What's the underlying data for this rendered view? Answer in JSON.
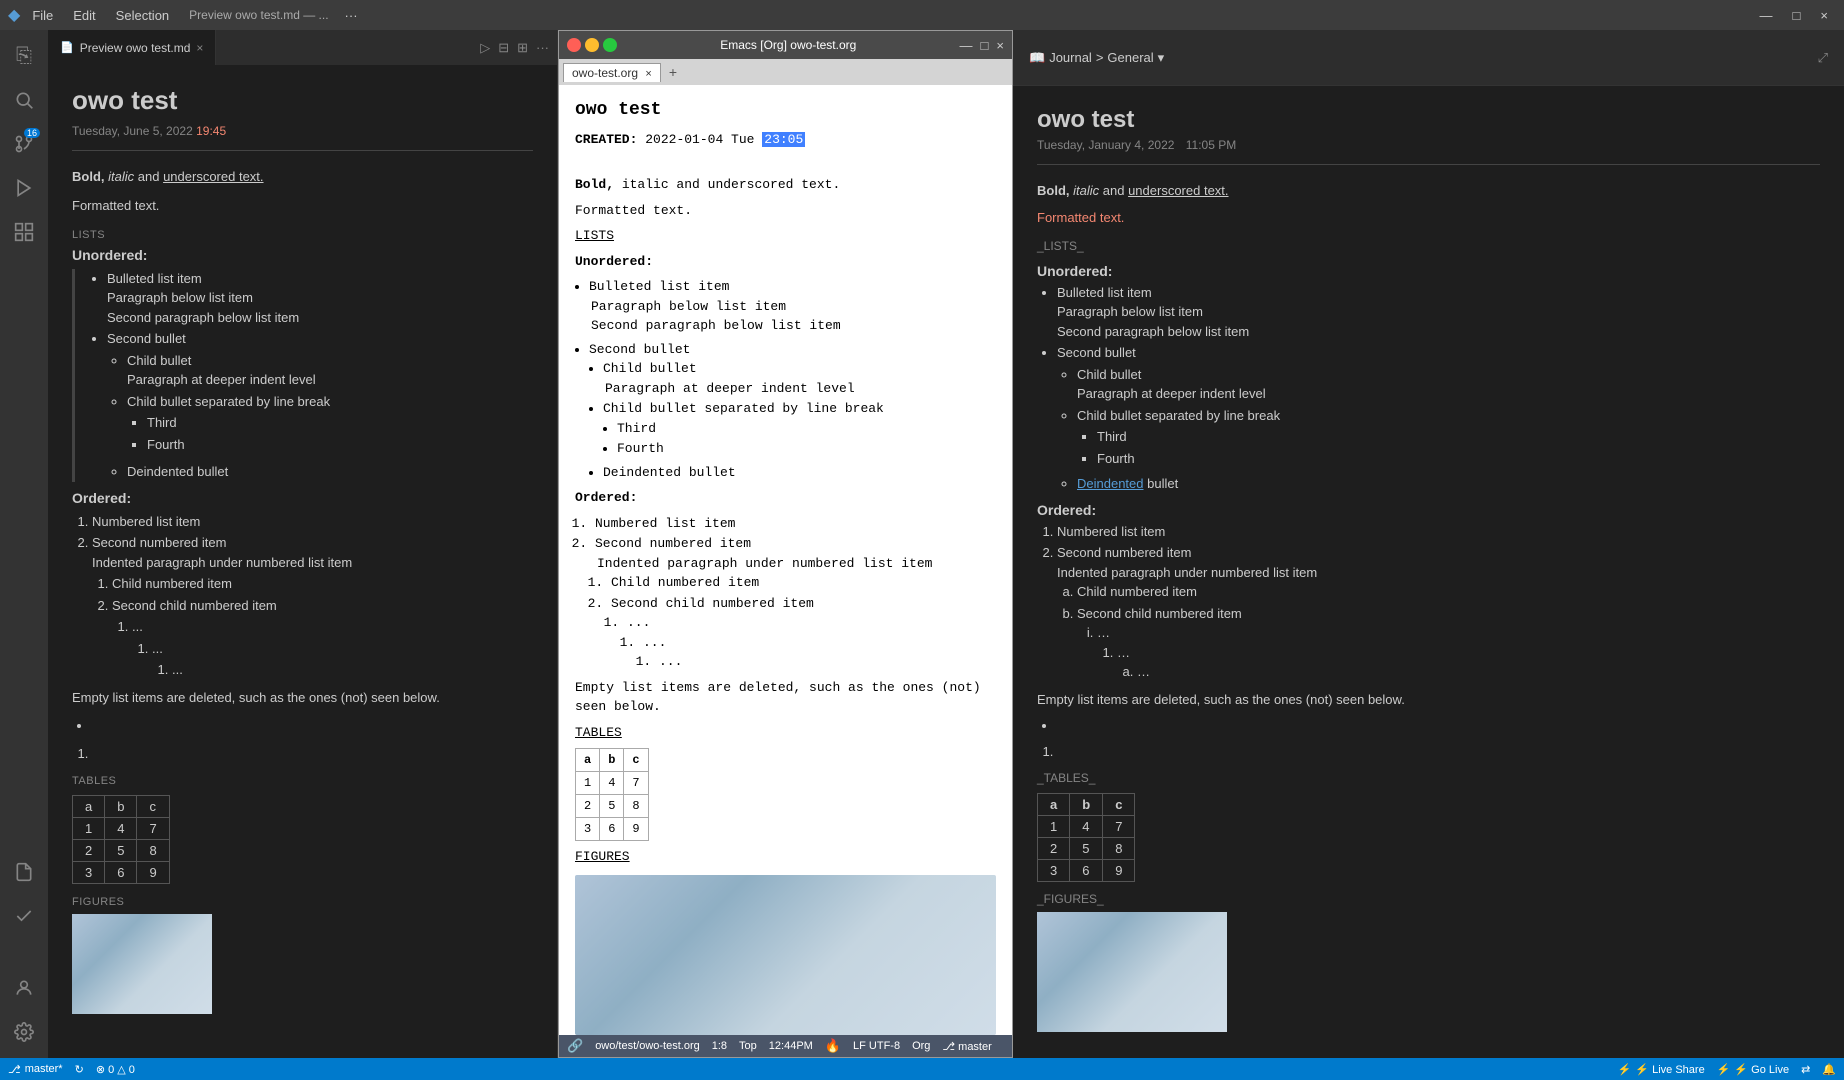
{
  "menubar": {
    "app_icon": "◆",
    "items": [
      "File",
      "Edit",
      "Selection",
      "Preview owo test.md — ...",
      ""
    ],
    "selection_label": "Selection",
    "file_label": "File",
    "edit_label": "Edit",
    "dots": "···"
  },
  "activity_bar": {
    "icons": [
      {
        "name": "explorer-icon",
        "symbol": "⎘",
        "active": false
      },
      {
        "name": "search-icon",
        "symbol": "🔍",
        "active": false
      },
      {
        "name": "source-control-icon",
        "symbol": "⎇",
        "badge": "16",
        "active": false
      },
      {
        "name": "run-icon",
        "symbol": "▷",
        "active": false
      },
      {
        "name": "extensions-icon",
        "symbol": "⊞",
        "active": false
      },
      {
        "name": "notes-icon",
        "symbol": "📝",
        "active": false
      },
      {
        "name": "todo-icon",
        "symbol": "✓",
        "active": false
      },
      {
        "name": "settings-icon",
        "symbol": "⚙",
        "active": false
      },
      {
        "name": "account-icon",
        "symbol": "👤",
        "active": false
      }
    ]
  },
  "vscode_panel": {
    "tab": {
      "icon": "📄",
      "label": "Preview owo test.md",
      "close": "×"
    },
    "toolbar": {
      "play_icon": "▷",
      "split_icon": "⊟",
      "grid_icon": "⊞",
      "more_icon": "···"
    },
    "content": {
      "title": "owo test",
      "date": "Tuesday, June 5, 2022",
      "time": "19:45",
      "line1_bold": "Bold,",
      "line1_italic": "italic",
      "line1_rest": " and underscored text.",
      "formatted_text": "Formatted text.",
      "lists_header": "LISTS",
      "unordered_heading": "Unordered:",
      "bullet1": "Bulleted list item",
      "paragraph_below1": "Paragraph below list item",
      "paragraph_below2": "Second paragraph below list item",
      "bullet2": "Second bullet",
      "child_bullet": "Child bullet",
      "paragraph_deeper": "Paragraph at deeper indent level",
      "child_bullet_line_break": "Child bullet separated by line break",
      "third": "Third",
      "fourth": "Fourth",
      "deindented_bullet": "Deindented bullet",
      "ordered_heading": "Ordered:",
      "numbered1": "Numbered list item",
      "numbered2": "Second numbered item",
      "indented_para": "Indented paragraph under numbered list item",
      "child_numbered1": "Child numbered item",
      "child_numbered2": "Second child numbered item",
      "nested1": "...",
      "nested2": "...",
      "nested3": "...",
      "empty_list_text": "Empty list items are deleted, such as the ones (not) seen below.",
      "bullet_empty": "•",
      "ordered_empty": "1.",
      "tables_header": "TABLES",
      "table_headers": [
        "a",
        "b",
        "c"
      ],
      "table_rows": [
        [
          "1",
          "4",
          "7"
        ],
        [
          "2",
          "5",
          "8"
        ],
        [
          "3",
          "6",
          "9"
        ]
      ],
      "figures_header": "FIGURES"
    }
  },
  "emacs_panel": {
    "titlebar": {
      "title": "Emacs [Org] owo-test.org",
      "min": "—",
      "max": "□",
      "close": "×"
    },
    "tabs": [
      {
        "label": "owo-test.org",
        "active": true,
        "close": "×"
      },
      {
        "label": "+",
        "active": false
      }
    ],
    "content": {
      "title": "owo test",
      "created_label": "CREATED:",
      "created_date": "2022-01-04 Tue",
      "created_time_highlight": "23:05",
      "bold_line": "Bold, italic and underscored text.",
      "formatted": "Formatted text.",
      "lists_label": "LISTS",
      "unordered_label": "Unordered:",
      "bullet1": "Bulleted list item",
      "para1": "Paragraph below list item",
      "para2": "Second paragraph below list item",
      "bullet2": "Second bullet",
      "child_bullet": "Child bullet",
      "para_deeper": "Paragraph at deeper indent level",
      "child_line_break": "Child bullet separated by line break",
      "third": "Third",
      "fourth": "Fourth",
      "deindented": "Deindented bullet",
      "ordered_label": "Ordered:",
      "num1": "Numbered list item",
      "num2": "Second numbered item",
      "indent_para": "Indented paragraph under numbered list item",
      "child_num1": "Child numbered item",
      "child_num2": "Second child numbered item",
      "nest1": "...",
      "nest2": "...",
      "nest3": "...",
      "empty_text": "Empty list items are deleted, such as the ones (not) seen below.",
      "tables_label": "TABLES",
      "table_headers": [
        "a",
        "b",
        "c"
      ],
      "table_rows": [
        [
          "1",
          "4",
          "7"
        ],
        [
          "2",
          "5",
          "8"
        ],
        [
          "3",
          "6",
          "9"
        ]
      ],
      "figures_label": "FIGURES"
    },
    "statusbar": {
      "file_icon": "🔗",
      "filepath": "owo/test/owo-test.org",
      "position": "1:8",
      "scroll": "Top",
      "time": "12:44PM",
      "warning_icon": "🔥",
      "encoding": "LF UTF-8",
      "mode": "Org",
      "branch_icon": "⎇",
      "branch": "master"
    }
  },
  "notes_panel": {
    "header": {
      "book_icon": "📖",
      "journal_label": "Journal",
      "arrow": ">",
      "general_label": "General",
      "chevron_icon": "▾",
      "expand_icon": "⤢"
    },
    "content": {
      "title": "owo test",
      "date": "Tuesday, January 4, 2022",
      "time": "11:05 PM",
      "bold_line_bold": "Bold,",
      "bold_line_italic": "italic",
      "bold_line_and": "and",
      "bold_line_underscored": "underscored text.",
      "formatted_red": "Formatted text.",
      "lists_section": "_LISTS_",
      "unordered_heading": "Unordered:",
      "bullet1": "Bulleted list item",
      "para1": "Paragraph below list item",
      "para2": "Second paragraph below list item",
      "bullet2": "Second bullet",
      "child_bullet": "Child bullet",
      "para_deeper": "Paragraph at deeper indent level",
      "child_line_break": "Child bullet separated by line break",
      "third": "Third",
      "fourth": "Fourth",
      "deindented": "Deindented",
      "deindented2": "bullet",
      "ordered_heading": "Ordered:",
      "num1": "Numbered list item",
      "num2": "Second numbered item",
      "indent_para": "Indented paragraph under numbered list item",
      "child_a": "Child numbered item",
      "child_b": "Second child numbered item",
      "nest_i": "…",
      "nest_1": "…",
      "nest_a": "…",
      "empty_text": "Empty list items are deleted, such as the ones (not) seen below.",
      "tables_section": "_TABLES_",
      "table_headers": [
        "a",
        "b",
        "c"
      ],
      "table_rows": [
        [
          "1",
          "4",
          "7"
        ],
        [
          "2",
          "5",
          "8"
        ],
        [
          "3",
          "6",
          "9"
        ]
      ],
      "figures_section": "_FIGURES_"
    }
  },
  "statusbar": {
    "branch_icon": "⎇",
    "branch": "master*",
    "sync_icon": "↻",
    "warnings": "⚠ 0",
    "errors": "⊗ 0 △ 0",
    "live_share": "⚡ Live Share",
    "go_live": "⚡ Go Live",
    "ports_icon": "⇄",
    "bell_icon": "🔔"
  }
}
